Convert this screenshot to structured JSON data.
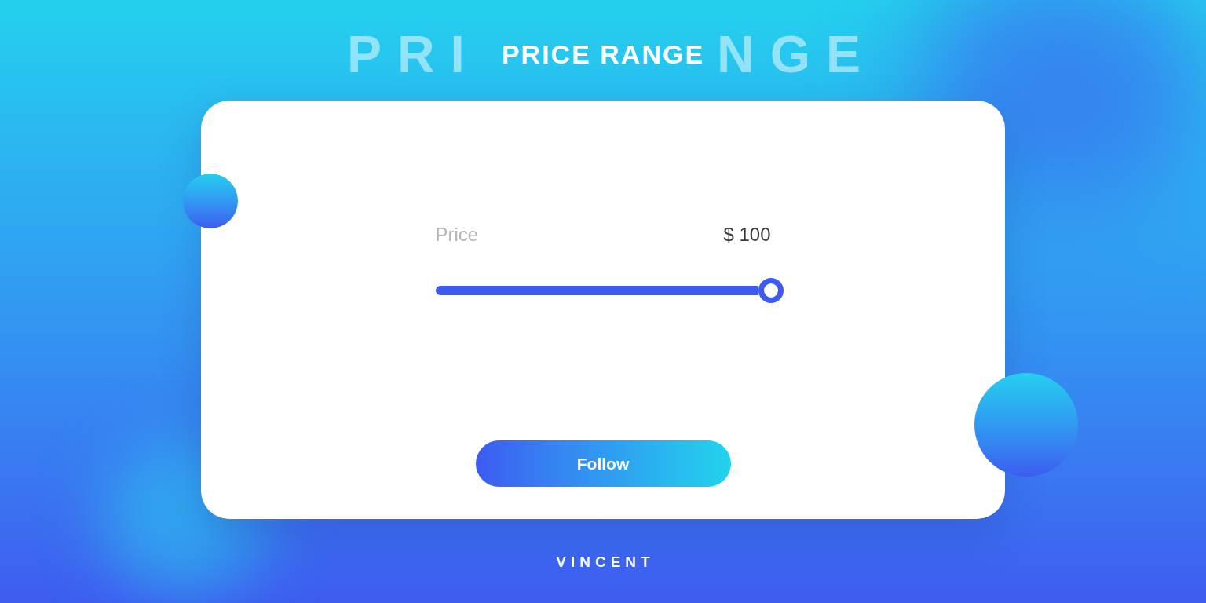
{
  "background_text": [
    "PRI",
    "NGE"
  ],
  "title": "PRICE RANGE",
  "card": {
    "slider": {
      "label": "Price",
      "value": "$ 100",
      "level": 1
    },
    "button": {
      "label": "Follow"
    }
  },
  "logo": {
    "text": "VINCENT"
  }
}
